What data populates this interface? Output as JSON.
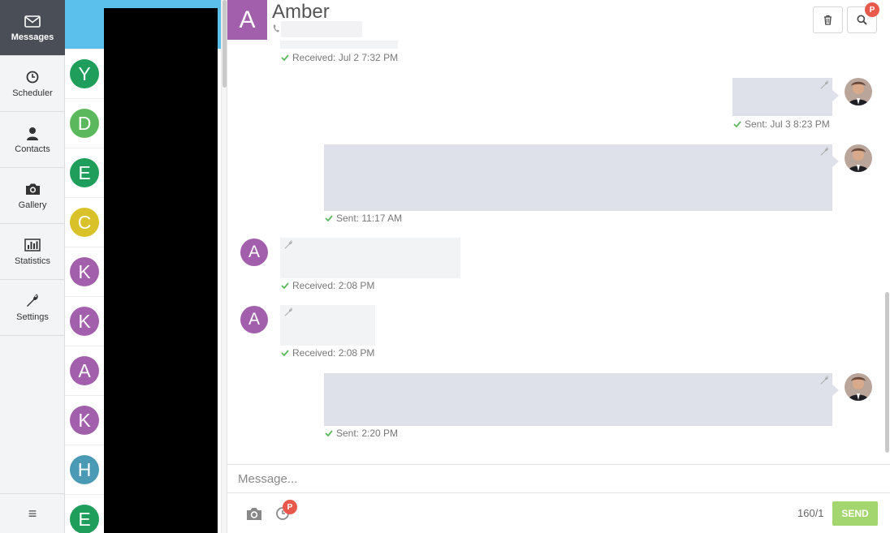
{
  "nav": {
    "items": [
      {
        "label": "Messages",
        "icon": "envelope-icon"
      },
      {
        "label": "Scheduler",
        "icon": "clock-icon"
      },
      {
        "label": "Contacts",
        "icon": "person-icon"
      },
      {
        "label": "Gallery",
        "icon": "camera-icon"
      },
      {
        "label": "Statistics",
        "icon": "bar-chart-icon"
      },
      {
        "label": "Settings",
        "icon": "wrench-icon"
      }
    ],
    "menu_glyph": "≡"
  },
  "contacts": [
    {
      "initial": "A",
      "color": "#a25fab"
    },
    {
      "initial": "Y",
      "color": "#1f9e5b"
    },
    {
      "initial": "D",
      "color": "#5cb85c"
    },
    {
      "initial": "E",
      "color": "#1f9e5b"
    },
    {
      "initial": "C",
      "color": "#d9c229"
    },
    {
      "initial": "K",
      "color": "#a25fab"
    },
    {
      "initial": "K",
      "color": "#a25fab"
    },
    {
      "initial": "A",
      "color": "#a25fab"
    },
    {
      "initial": "K",
      "color": "#a25fab"
    },
    {
      "initial": "H",
      "color": "#4a9ab5"
    },
    {
      "initial": "E",
      "color": "#1f9e5b"
    }
  ],
  "header": {
    "initial": "A",
    "name": "Amber",
    "badge": "P"
  },
  "messages": [
    {
      "direction": "received",
      "status": "Received: Jul 2 7:32 PM"
    },
    {
      "direction": "sent",
      "status": "Sent: Jul 3 8:23 PM"
    },
    {
      "direction": "sent",
      "status": "Sent: 11:17 AM"
    },
    {
      "direction": "received",
      "initial": "A",
      "status": "Received: 2:08 PM"
    },
    {
      "direction": "received",
      "initial": "A",
      "status": "Received: 2:08 PM"
    },
    {
      "direction": "sent",
      "status": "Sent: 2:20 PM"
    }
  ],
  "composer": {
    "placeholder": "Message...",
    "char_count": "160/1",
    "send_label": "SEND",
    "badge": "P"
  },
  "colors": {
    "accent": "#5bc0eb",
    "send": "#a3d66f",
    "badge": "#e8594c"
  }
}
